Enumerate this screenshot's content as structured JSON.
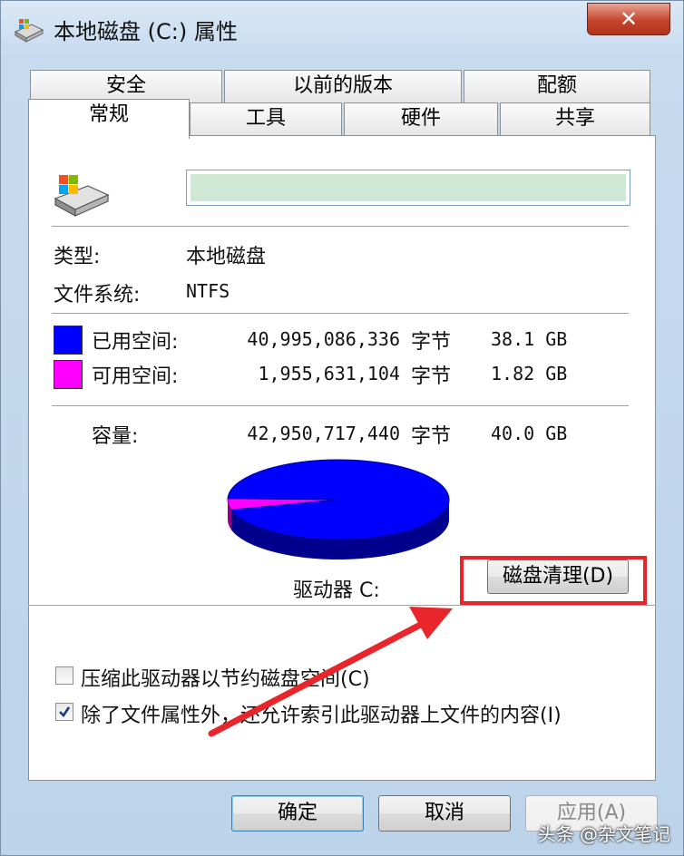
{
  "window": {
    "title": "本地磁盘 (C:) 属性",
    "close_label": "✕"
  },
  "tabs": {
    "row1": [
      "安全",
      "以前的版本",
      "配额"
    ],
    "row2": [
      "常规",
      "工具",
      "硬件",
      "共享"
    ],
    "active": "常规"
  },
  "general": {
    "volume_name": "",
    "type_label": "类型:",
    "type_value": "本地磁盘",
    "fs_label": "文件系统:",
    "fs_value": "NTFS",
    "used": {
      "label": "已用空间:",
      "bytes": "40,995,086,336",
      "unit": "字节",
      "size": "38.1 GB",
      "color": "#0000ff"
    },
    "free": {
      "label": "可用空间:",
      "bytes": "1,955,631,104",
      "unit": "字节",
      "size": "1.82 GB",
      "color": "#ff00ff"
    },
    "capacity": {
      "label": "容量:",
      "bytes": "42,950,717,440",
      "unit": "字节",
      "size": "40.0 GB"
    },
    "drive_label": "驱动器 C:",
    "cleanup_button": "磁盘清理(D)",
    "compress_checkbox": {
      "label": "压缩此驱动器以节约磁盘空间(C)",
      "checked": false
    },
    "index_checkbox": {
      "label": "除了文件属性外，还允许索引此驱动器上文件的内容(I)",
      "checked": true
    }
  },
  "footer": {
    "ok": "确定",
    "cancel": "取消",
    "apply": "应用(A)"
  },
  "watermark": "头条 @杂文笔记",
  "colors": {
    "used": "#0000ff",
    "free": "#ff00ff",
    "annotation": "#e8252a"
  },
  "chart_data": {
    "type": "pie",
    "categories": [
      "已用空间",
      "可用空间"
    ],
    "values": [
      40995086336,
      1955631104
    ],
    "colors": [
      "#0000ff",
      "#ff00ff"
    ]
  }
}
